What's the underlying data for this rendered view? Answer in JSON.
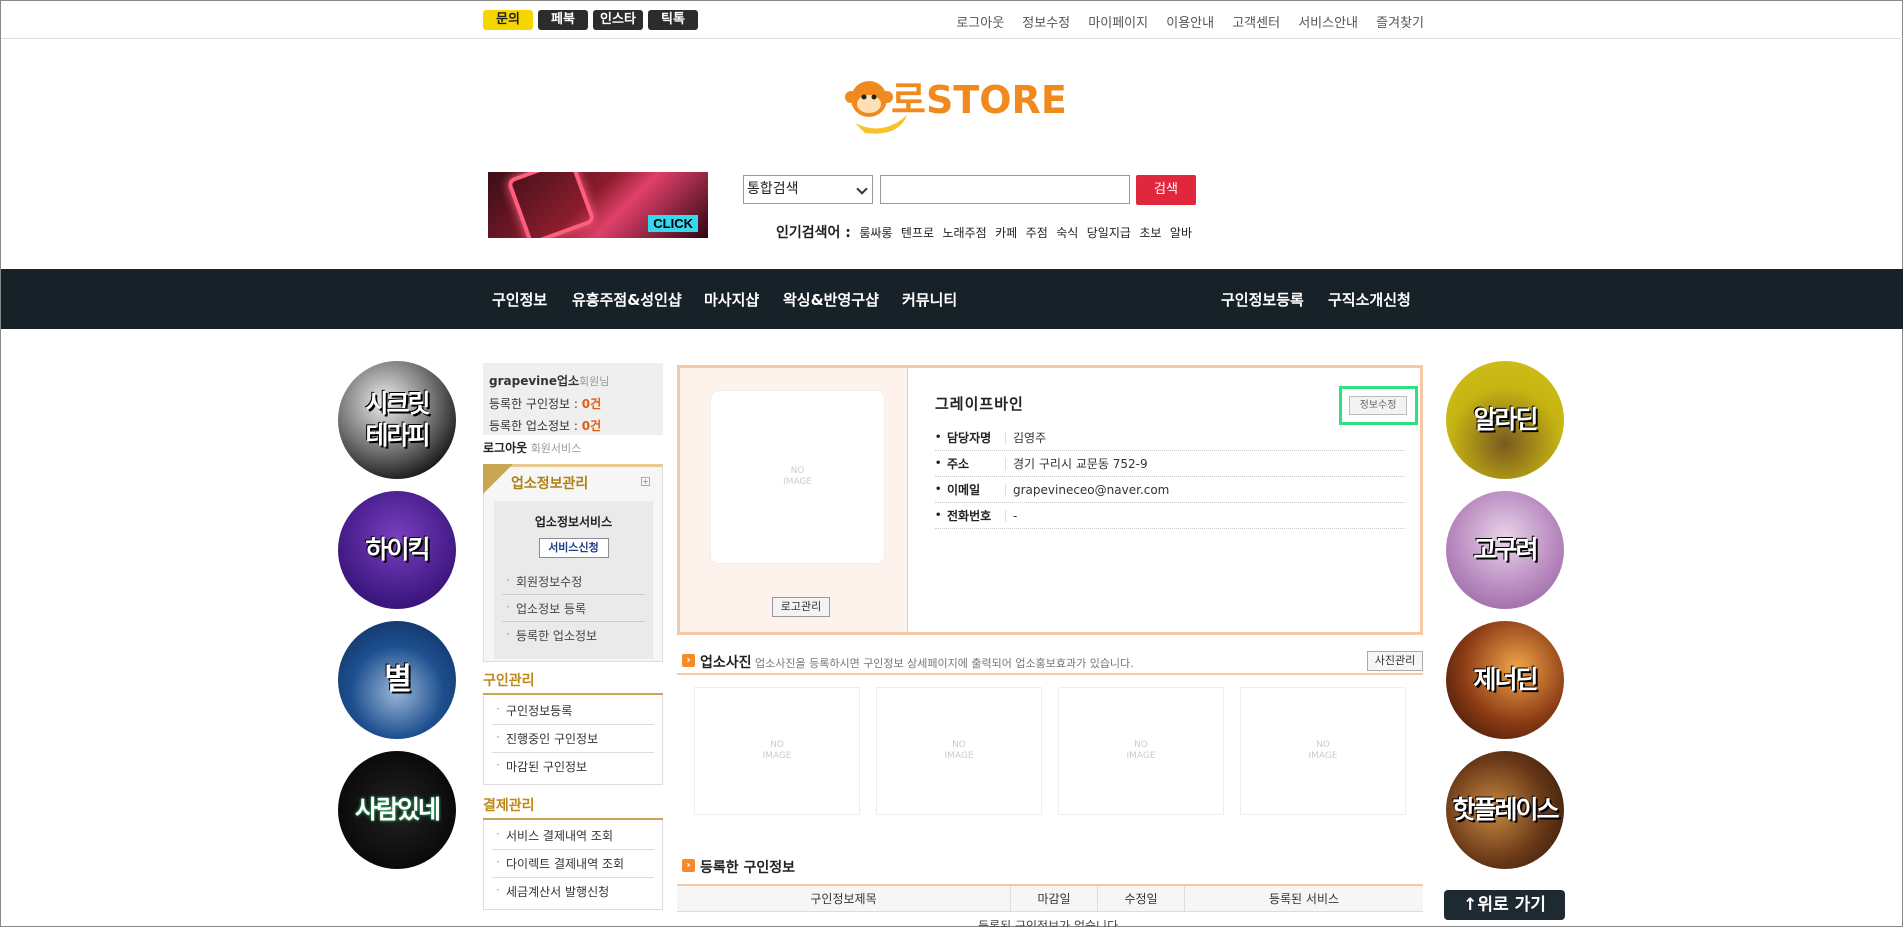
{
  "topbar": {
    "sns": [
      "문의",
      "페북",
      "인스타",
      "틱톡"
    ],
    "links": [
      "로그아웃",
      "정보수정",
      "마이페이지",
      "이용안내",
      "고객센터",
      "서비스안내",
      "즐겨찾기"
    ]
  },
  "header": {
    "logo_text": "로STORE",
    "banner_click": "CLICK",
    "search_select": "통합검색",
    "search_button": "검색",
    "popular_label": "인기검색어 :",
    "popular_keywords": [
      "룸싸롱",
      "텐프로",
      "노래주점",
      "카페",
      "주점",
      "숙식",
      "당일지급",
      "초보",
      "알바"
    ]
  },
  "nav": {
    "left": [
      "구인정보",
      "유흥주점&성인샵",
      "마사지샵",
      "왁싱&반영구샵",
      "커뮤니티"
    ],
    "right": [
      "구인정보등록",
      "구직소개신청"
    ]
  },
  "left_circles": [
    "시크릿\n테라피",
    "하이킥",
    "별",
    "사람있네"
  ],
  "right_circles": [
    "알라딘",
    "고구려",
    "제너딘",
    "핫플레이스"
  ],
  "member": {
    "id": "grapevine",
    "type": "업소",
    "suffix": "회원님",
    "job_label": "등록한 구인정보 : ",
    "job_count": "0건",
    "biz_label": "등록한 업소정보 : ",
    "biz_count": "0건",
    "logout": "로그아웃",
    "member_service": "회원서비스"
  },
  "biz_menu": {
    "title": "업소정보관리",
    "plus": "+",
    "service_title": "업소정보서비스",
    "service_button": "서비스신청",
    "items": [
      "회원정보수정",
      "업소정보 등록",
      "등록한 업소정보"
    ]
  },
  "job_menu": {
    "title": "구인관리",
    "items": [
      "구인정보등록",
      "진행중인 구인정보",
      "마감된 구인정보"
    ]
  },
  "pay_menu": {
    "title": "결제관리",
    "items": [
      "서비스 결제내역 조회",
      "다이렉트 결제내역 조회",
      "세금계산서 발행신청"
    ]
  },
  "profile": {
    "no_image": "NO\nIMAGE",
    "logo_button": "로고관리",
    "name": "그레이프바인",
    "edit_button": "정보수정",
    "rows": [
      {
        "k": "담당자명",
        "v": "김영주"
      },
      {
        "k": "주소",
        "v": "경기 구리시 교문동 752-9"
      },
      {
        "k": "이메일",
        "v": "grapevineceo@naver.com"
      },
      {
        "k": "전화번호",
        "v": "-"
      }
    ]
  },
  "photos": {
    "title": "업소사진",
    "desc": "업소사진을 등록하시면 구인정보 상세페이지에 출력되어 업소홍보효과가 있습니다.",
    "button": "사진관리",
    "no_image": "NO\nIMAGE"
  },
  "jobs": {
    "title": "등록한 구인정보",
    "columns": [
      "구인정보제목",
      "마감일",
      "수정일",
      "등록된 서비스"
    ],
    "empty": "등록된 구인정보가 없습니다."
  },
  "top_button": "↑위로 가기",
  "colors": {
    "nav_bg": "#172128",
    "accent_red": "#e0273e",
    "accent_orange": "#f58a2a",
    "highlight_green": "#2fe07f"
  }
}
